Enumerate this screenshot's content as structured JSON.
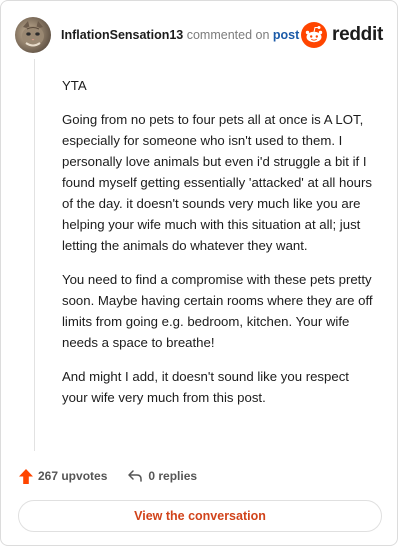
{
  "header": {
    "username": "InflationSensation13",
    "commented_on": "commented on",
    "post_link": "post",
    "logo_text": "reddit"
  },
  "comment": {
    "paragraphs": [
      "YTA",
      "Going from no pets to four pets all at once is A LOT, especially for someone who isn't used to them. I personally love animals but even i'd struggle a bit if I found myself getting essentially 'attacked' at all hours of the day. it doesn't sounds very much like you are helping your wife much with this situation at all; just letting the animals do whatever they want.",
      "You need to find a compromise with these pets pretty soon. Maybe having certain rooms where they are off limits from going e.g. bedroom, kitchen. Your wife needs a space to breathe!",
      "And might I add, it doesn't sound like you respect your wife very much from this post."
    ]
  },
  "actions": {
    "upvotes": "267 upvotes",
    "replies": "0 replies"
  },
  "view_button": "View the conversation",
  "colors": {
    "reddit_orange": "#ff4500",
    "link_blue": "#1a5aa8",
    "button_text": "#d1431a"
  }
}
